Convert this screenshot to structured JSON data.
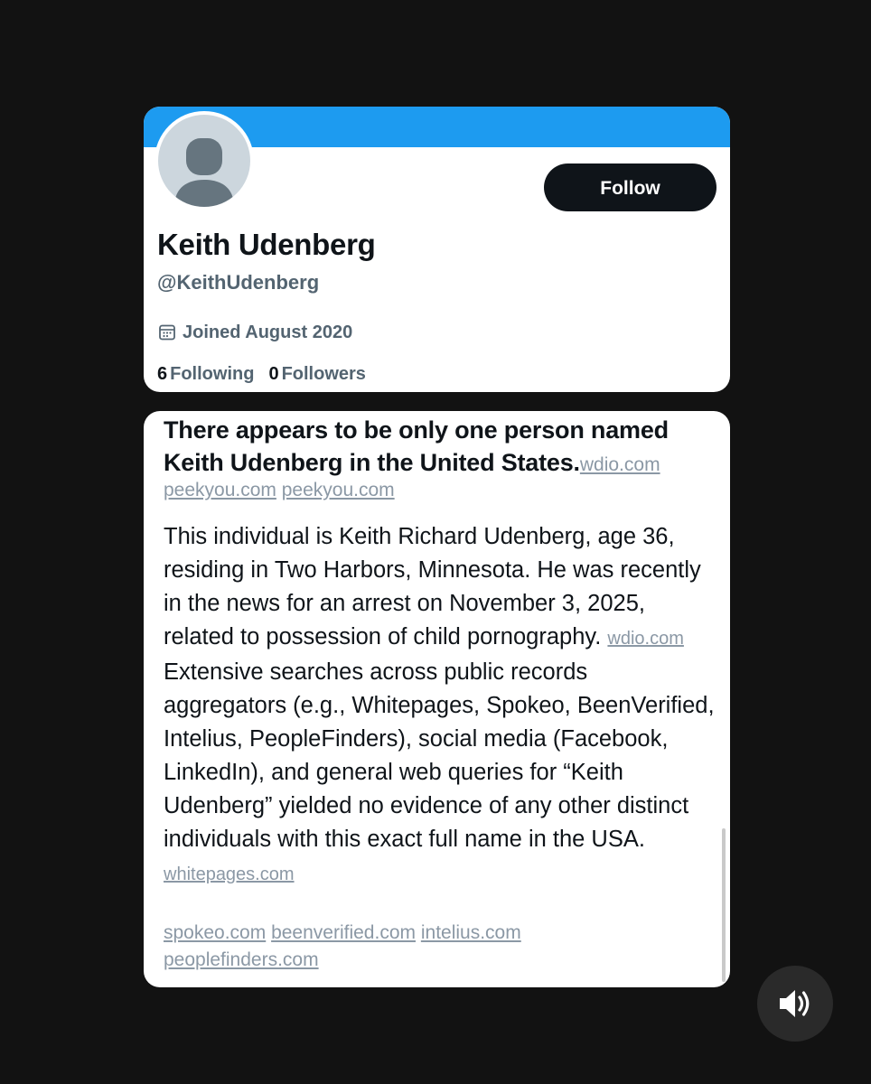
{
  "profile": {
    "display_name": "Keith Udenberg",
    "handle": "@KeithUdenberg",
    "joined": "Joined August 2020",
    "follow_label": "Follow",
    "following_count": "6",
    "following_label": "Following",
    "followers_count": "0",
    "followers_label": "Followers",
    "banner_color": "#1d9bf0",
    "avatar_icon": "default-avatar-icon",
    "joined_icon": "calendar-icon"
  },
  "result": {
    "headline": "There appears to be only one person named Keith Udenberg in the United States.",
    "headline_sources": [
      "wdio.com",
      "peekyou.com",
      "peekyou.com"
    ],
    "body_part1": "This individual is Keith Richard Udenberg, age 36, residing in Two Harbors, Minnesota. He was recently in the news for an arrest on November 3, 2025, related to possession of child pornography.",
    "body_source1": "wdio.com",
    "body_part2": "Extensive searches across public records aggregators (e.g., Whitepages, Spokeo, BeenVerified, Intelius, PeopleFinders), social media (Facebook, LinkedIn), and general web queries for “Keith Udenberg” yielded no evidence of any other distinct individuals with this exact full name in the USA.",
    "body_sources2": [
      "whitepages.com",
      "spokeo.com",
      "beenverified.com",
      "intelius.com",
      "peoplefinders.com"
    ]
  },
  "controls": {
    "sound_icon": "speaker-volume-icon"
  }
}
